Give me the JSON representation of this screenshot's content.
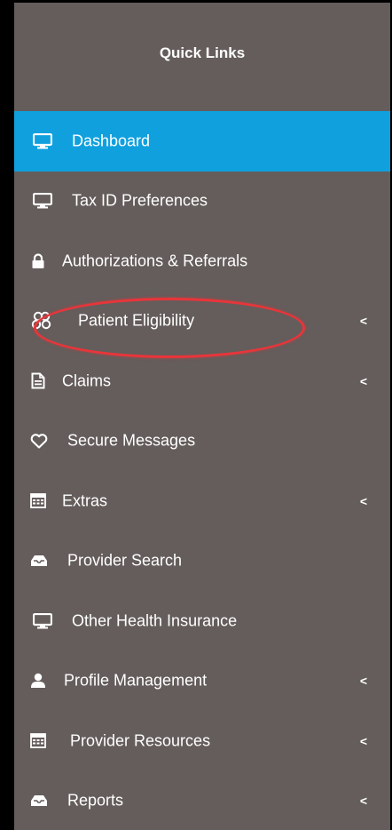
{
  "sidebar": {
    "title": "Quick Links",
    "chevron": "<",
    "items": [
      {
        "label": "Dashboard",
        "icon": "monitor-icon"
      },
      {
        "label": "Tax ID Preferences",
        "icon": "monitor-icon"
      },
      {
        "label": "Authorizations & Referrals",
        "icon": "lock-icon"
      },
      {
        "label": "Patient Eligibility",
        "icon": "group-icon"
      },
      {
        "label": "Claims",
        "icon": "document-icon"
      },
      {
        "label": "Secure Messages",
        "icon": "heart-icon"
      },
      {
        "label": "Extras",
        "icon": "calculator-icon"
      },
      {
        "label": "Provider Search",
        "icon": "inbox-icon"
      },
      {
        "label": "Other Health Insurance",
        "icon": "monitor-icon"
      },
      {
        "label": "Profile Management",
        "icon": "user-icon"
      },
      {
        "label": "Provider Resources",
        "icon": "calculator-icon"
      },
      {
        "label": "Reports",
        "icon": "inbox-icon"
      }
    ]
  },
  "colors": {
    "panel": "#645d5b",
    "active": "#10a0de",
    "highlight": "#e8353a"
  }
}
